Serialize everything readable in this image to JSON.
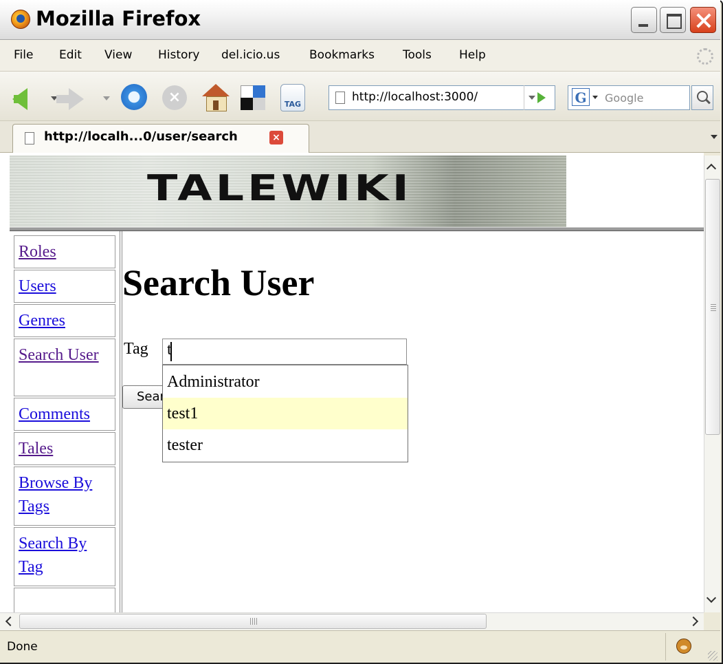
{
  "window": {
    "title": "Mozilla Firefox"
  },
  "menu": [
    "File",
    "Edit",
    "View",
    "History",
    "del.icio.us",
    "Bookmarks",
    "Tools",
    "Help"
  ],
  "toolbar": {
    "url": "http://localhost:3000/",
    "search_placeholder": "Google",
    "tag_button_label": "TAG",
    "stop_glyph": "×"
  },
  "tab": {
    "title": "http://localh...0/user/search",
    "close_glyph": "×"
  },
  "banner": {
    "title": "TALEWIKI"
  },
  "sidebar": {
    "items": [
      {
        "label": "Roles",
        "visited": true
      },
      {
        "label": "Users",
        "visited": false
      },
      {
        "label": "Genres",
        "visited": false
      },
      {
        "label": "Search User",
        "visited": true
      },
      {
        "label": "Comments",
        "visited": false
      },
      {
        "label": "Tales",
        "visited": true
      },
      {
        "label": "Browse By Tags",
        "visited": false
      },
      {
        "label": "Search By Tag",
        "visited": false
      }
    ]
  },
  "main": {
    "title": "Search User",
    "tag_label": "Tag",
    "tag_value": "t",
    "search_button_label": "Search",
    "suggestions": [
      {
        "label": "Administrator",
        "selected": false
      },
      {
        "label": "test1",
        "selected": true
      },
      {
        "label": "tester",
        "selected": false
      }
    ]
  },
  "status": {
    "text": "Done"
  },
  "colors": {
    "link": "#1a0ddb",
    "visited": "#551a8b",
    "highlight": "#ffffcc"
  },
  "icons": [
    "firefox-logo-icon",
    "back-icon",
    "forward-icon",
    "reload-icon",
    "stop-icon",
    "home-icon",
    "delicious-icon",
    "tag-icon",
    "page-icon",
    "go-icon",
    "google-icon",
    "search-icon",
    "close-icon",
    "monkey-icon"
  ]
}
